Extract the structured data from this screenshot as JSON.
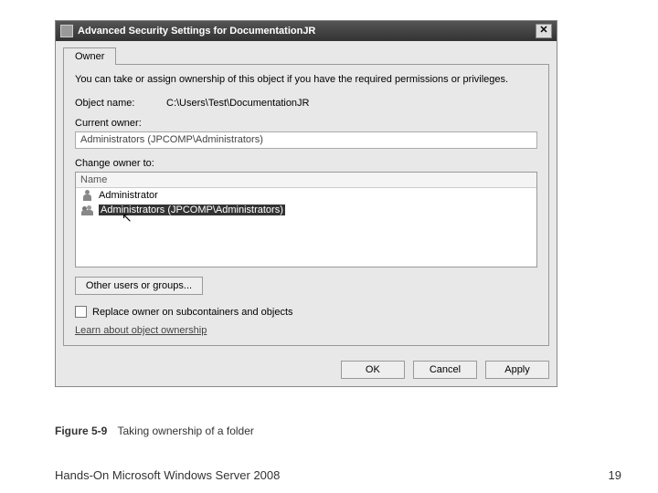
{
  "dialog": {
    "title": "Advanced Security Settings for DocumentationJR",
    "tab": "Owner",
    "description": "You can take or assign ownership of this object if you have the required permissions or privileges.",
    "object_label": "Object name:",
    "object_name": "C:\\Users\\Test\\DocumentationJR",
    "current_owner_label": "Current owner:",
    "current_owner": "Administrators (JPCOMP\\Administrators)",
    "change_owner_label": "Change owner to:",
    "list_header": "Name",
    "owners": [
      {
        "name": "Administrator",
        "selected": false,
        "type": "user"
      },
      {
        "name": "Administrators (JPCOMP\\Administrators)",
        "selected": true,
        "type": "group"
      }
    ],
    "other_users_btn": "Other users or groups...",
    "replace_checkbox": "Replace owner on subcontainers and objects",
    "learn_link": "Learn about object ownership",
    "buttons": {
      "ok": "OK",
      "cancel": "Cancel",
      "apply": "Apply"
    }
  },
  "figure": {
    "label": "Figure 5-9",
    "caption": "Taking ownership of a folder"
  },
  "footer": {
    "book": "Hands-On Microsoft Windows Server 2008",
    "page": "19"
  }
}
